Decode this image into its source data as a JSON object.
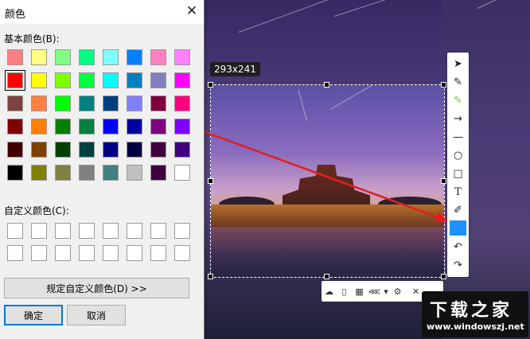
{
  "dialog": {
    "title": "颜色",
    "basic_label": "基本颜色(B):",
    "custom_label": "自定义颜色(C):",
    "define_button": "规定自定义颜色(D) >>",
    "ok_button": "确定",
    "cancel_button": "取消",
    "basic_colors": [
      [
        "#ff8080",
        "#ffff80",
        "#80ff80",
        "#00ff80",
        "#80ffff",
        "#0080ff",
        "#ff80c0",
        "#ff80ff"
      ],
      [
        "#ff0000",
        "#ffff00",
        "#80ff00",
        "#00ff40",
        "#00ffff",
        "#0080c0",
        "#8080c0",
        "#ff00ff"
      ],
      [
        "#804040",
        "#ff8040",
        "#00ff00",
        "#008080",
        "#004080",
        "#8080ff",
        "#800040",
        "#ff0080"
      ],
      [
        "#800000",
        "#ff8000",
        "#008000",
        "#008040",
        "#0000ff",
        "#0000a0",
        "#800080",
        "#8000ff"
      ],
      [
        "#400000",
        "#804000",
        "#004000",
        "#004040",
        "#000080",
        "#000040",
        "#400040",
        "#400080"
      ],
      [
        "#000000",
        "#808000",
        "#808040",
        "#808080",
        "#408080",
        "#c0c0c0",
        "#400040",
        "#ffffff"
      ]
    ],
    "selected_color_index": [
      1,
      0
    ],
    "custom_colors_count": 16
  },
  "screenshot_tool": {
    "size_label": "293x241",
    "vertical_tools": [
      {
        "name": "select-tool",
        "icon": "cursor-icon",
        "glyph": "➤"
      },
      {
        "name": "pen-tool",
        "icon": "pen-icon",
        "glyph": "✎"
      },
      {
        "name": "highlighter-tool",
        "icon": "highlighter-icon",
        "glyph": "✎"
      },
      {
        "name": "arrow-tool",
        "icon": "arrow-icon",
        "glyph": "→"
      },
      {
        "name": "line-tool",
        "icon": "line-icon",
        "glyph": "—"
      },
      {
        "name": "ellipse-tool",
        "icon": "circle-icon",
        "glyph": "○"
      },
      {
        "name": "rectangle-tool",
        "icon": "rectangle-icon",
        "glyph": "□"
      },
      {
        "name": "text-tool",
        "icon": "text-icon",
        "glyph": "T"
      },
      {
        "name": "eyedropper-tool",
        "icon": "eyedropper-icon",
        "glyph": "✐"
      },
      {
        "name": "color-swatch",
        "icon": "color-swatch-icon",
        "glyph": ""
      },
      {
        "name": "undo-tool",
        "icon": "undo-icon",
        "glyph": "↶"
      },
      {
        "name": "redo-tool",
        "icon": "redo-icon",
        "glyph": "↷"
      }
    ],
    "current_color": "#1e90ff",
    "horizontal_tools": [
      {
        "name": "upload-button",
        "icon": "cloud-upload-icon",
        "glyph": "☁"
      },
      {
        "name": "copy-button",
        "icon": "clipboard-icon",
        "glyph": "▯"
      },
      {
        "name": "qrcode-button",
        "icon": "qrcode-icon",
        "glyph": "▦"
      },
      {
        "name": "share-button",
        "icon": "share-icon",
        "glyph": "⋘"
      },
      {
        "name": "share-dropdown",
        "icon": "chevron-down-icon",
        "glyph": "▾"
      },
      {
        "name": "settings-button",
        "icon": "gear-icon",
        "glyph": "⚙"
      },
      {
        "name": "close-button",
        "icon": "close-icon",
        "glyph": "✕"
      }
    ],
    "arrow_color": "#e02020"
  },
  "watermark": {
    "title": "下载之家",
    "url": "www.windowszj.net"
  }
}
